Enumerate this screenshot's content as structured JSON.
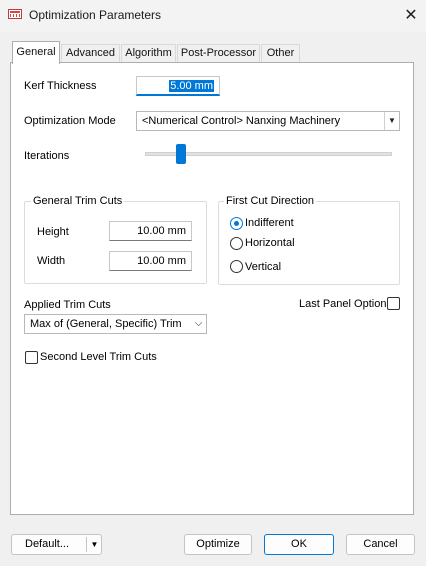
{
  "window": {
    "title": "Optimization Parameters",
    "icon": "app-grid-icon",
    "close_glyph": "✕"
  },
  "tabs": [
    {
      "label": "General",
      "active": true
    },
    {
      "label": "Advanced"
    },
    {
      "label": "Algorithm"
    },
    {
      "label": "Post-Processor"
    },
    {
      "label": "Other"
    }
  ],
  "general": {
    "kerf_label": "Kerf Thickness",
    "kerf_value": "5.00 mm",
    "mode_label": "Optimization Mode",
    "mode_value": "<Numerical Control> Nanxing Machinery",
    "iterations_label": "Iterations",
    "iterations_level": 0.13,
    "trim_group_title": "General Trim Cuts",
    "height_label": "Height",
    "height_value": "10.00 mm",
    "width_label": "Width",
    "width_value": "10.00 mm",
    "first_cut_title": "First Cut Direction",
    "first_cut_options": [
      "Indifferent",
      "Horizontal",
      "Vertical"
    ],
    "first_cut_selected": "Indifferent",
    "applied_trim_label": "Applied Trim Cuts",
    "applied_trim_value": "Max of (General, Specific) Trim Cu",
    "last_panel_label": "Last Panel Option",
    "last_panel_checked": false,
    "second_level_label": "Second Level Trim Cuts",
    "second_level_checked": false
  },
  "footer": {
    "default_label": "Default...",
    "optimize_label": "Optimize",
    "ok_label": "OK",
    "cancel_label": "Cancel"
  },
  "colors": {
    "accent": "#0078d7",
    "background": "#f0f0f0",
    "panel": "#ffffff"
  }
}
